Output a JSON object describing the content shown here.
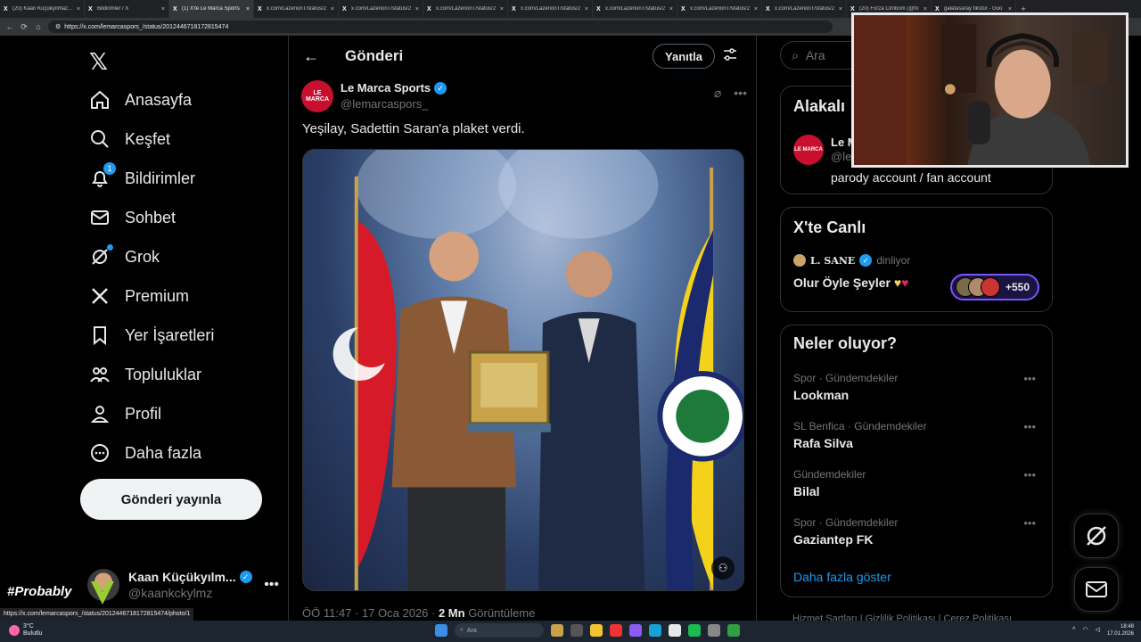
{
  "browser": {
    "tabs": [
      {
        "label": "(20) Kaan Küçükyılmaz (@",
        "active": false
      },
      {
        "label": "Bildirimler / X",
        "active": false
      },
      {
        "label": "(1) X'te Le Marca Sports",
        "active": true
      },
      {
        "label": "x.com/LazerionT/status/2",
        "active": false
      },
      {
        "label": "x.com/LazerionT/status/2",
        "active": false
      },
      {
        "label": "x.com/LazerionT/status/2",
        "active": false
      },
      {
        "label": "x.com/LazerionT/status/2",
        "active": false
      },
      {
        "label": "x.com/LazerionT/status/2",
        "active": false
      },
      {
        "label": "x.com/LazerionT/status/2",
        "active": false
      },
      {
        "label": "x.com/LazerionT/status/2",
        "active": false
      },
      {
        "label": "(20) Forza Cimbom (@fo",
        "active": false
      },
      {
        "label": "galatasaray fikstür - Goo",
        "active": false
      }
    ],
    "url": "https://x.com/lemarcaspors_/status/2012446718172815474"
  },
  "nav": {
    "items": [
      {
        "label": "Anasayfa",
        "icon": "home-icon"
      },
      {
        "label": "Keşfet",
        "icon": "search-icon"
      },
      {
        "label": "Bildirimler",
        "icon": "bell-icon",
        "badge": "1"
      },
      {
        "label": "Sohbet",
        "icon": "mail-icon"
      },
      {
        "label": "Grok",
        "icon": "grok-icon"
      },
      {
        "label": "Premium",
        "icon": "x-icon"
      },
      {
        "label": "Yer İşaretleri",
        "icon": "bookmark-icon"
      },
      {
        "label": "Topluluklar",
        "icon": "communities-icon"
      },
      {
        "label": "Profil",
        "icon": "profile-icon"
      },
      {
        "label": "Daha fazla",
        "icon": "more-circle-icon"
      }
    ],
    "post_button": "Gönderi yayınla",
    "account": {
      "name": "Kaan Küçükyılm...",
      "handle": "@kaankckylmz"
    }
  },
  "main": {
    "title": "Gönderi",
    "reply_button": "Yanıtla",
    "post": {
      "author_name": "Le Marca Sports",
      "author_handle": "@lemarcaspors_",
      "logo_text": "LE MARCA",
      "text": "Yeşilay, Sadettin Saran'a plaket verdi.",
      "time": "ÖÖ 11:47 · 17 Oca 2026 · ",
      "views": "2 Mn",
      "views_label": " Görüntüleme"
    }
  },
  "right": {
    "search_placeholder": "Ara",
    "related": {
      "title": "Alakalı",
      "name": "Le M",
      "handle": "@le",
      "bio": "parody account / fan account"
    },
    "live": {
      "title": "X'te Canlı",
      "host": "L. SANE",
      "status": "dinliyor",
      "space_title": "Olur Öyle Şeyler",
      "listeners": "+550"
    },
    "trends": {
      "title": "Neler oluyor?",
      "items": [
        {
          "category": "Spor · Gündemdekiler",
          "name": "Lookman"
        },
        {
          "category": "SL Benfica · Gündemdekiler",
          "name": "Rafa Silva"
        },
        {
          "category": "Gündemdekiler",
          "name": "Bilal"
        },
        {
          "category": "Spor · Gündemdekiler",
          "name": "Gaziantep FK"
        }
      ],
      "show_more": "Daha fazla göster"
    },
    "footer": "Hizmet Şartları  |  Gizlilik Politikası  |  Çerez Politikası"
  },
  "overlay": {
    "status_url": "https://x.com/lemarcaspors_/status/2012446718172815474/photo/1",
    "tag": "#Probably"
  },
  "taskbar": {
    "temp": "3°C",
    "weather": "Bulutlu",
    "search": "Ara",
    "time": "18:48",
    "date": "17.01.2026"
  }
}
